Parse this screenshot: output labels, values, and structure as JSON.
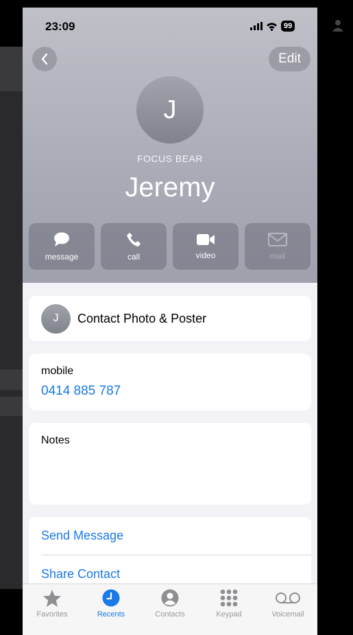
{
  "status": {
    "time": "23:09",
    "battery": "99"
  },
  "header": {
    "edit_label": "Edit",
    "avatar_initial": "J",
    "company": "FOCUS BEAR",
    "name": "Jeremy"
  },
  "actions": [
    {
      "label": "message",
      "icon": "message-bubble-icon",
      "enabled": true
    },
    {
      "label": "call",
      "icon": "phone-icon",
      "enabled": true
    },
    {
      "label": "video",
      "icon": "video-camera-icon",
      "enabled": true
    },
    {
      "label": "mail",
      "icon": "envelope-icon",
      "enabled": false
    }
  ],
  "contact_photo": {
    "initial": "J",
    "label": "Contact Photo & Poster"
  },
  "mobile": {
    "label": "mobile",
    "number": "0414 885 787"
  },
  "notes": {
    "label": "Notes"
  },
  "links": {
    "send_message": "Send Message",
    "share_contact": "Share Contact"
  },
  "tabbar": [
    {
      "label": "Favorites",
      "icon": "star-icon",
      "active": false
    },
    {
      "label": "Recents",
      "icon": "clock-icon",
      "active": true
    },
    {
      "label": "Contacts",
      "icon": "person-circle-icon",
      "active": false
    },
    {
      "label": "Keypad",
      "icon": "keypad-icon",
      "active": false
    },
    {
      "label": "Voicemail",
      "icon": "voicemail-icon",
      "active": false
    }
  ],
  "colors": {
    "accent": "#1a7ae8",
    "header_gray": "#a9abb6",
    "background": "#f2f2f7"
  }
}
